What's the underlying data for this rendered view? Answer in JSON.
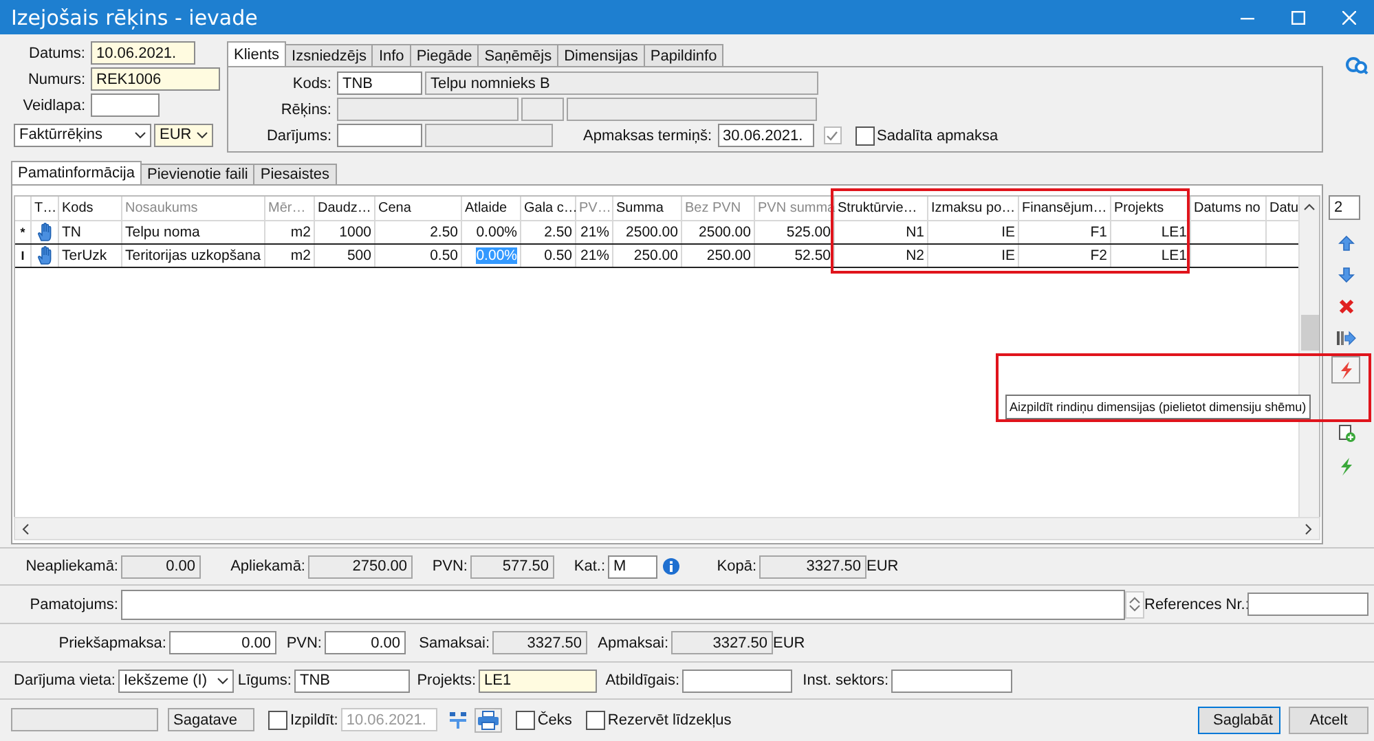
{
  "window": {
    "title": "Izejošais rēķins - ievade"
  },
  "header": {
    "datums": {
      "label": "Datums:",
      "value": "10.06.2021.",
      "highlighted": true
    },
    "numurs": {
      "label": "Numurs:",
      "value": "REK1006",
      "highlighted": true
    },
    "veidlapa": {
      "label": "Veidlapa:"
    },
    "doc_type": "Faktūrrēķins",
    "currency": "EUR"
  },
  "party_tabs": [
    {
      "label": "Klients",
      "selected": true
    },
    {
      "label": "Izsniedzējs",
      "selected": false
    },
    {
      "label": "Info",
      "selected": false
    },
    {
      "label": "Piegāde",
      "selected": false
    },
    {
      "label": "Saņēmējs",
      "selected": false
    },
    {
      "label": "Dimensijas",
      "selected": false
    },
    {
      "label": "Papildinfo",
      "selected": false
    }
  ],
  "client": {
    "kods_label": "Kods:",
    "kods": "TNB",
    "name": "Telpu nomnieks B",
    "rekins_label": "Rēķins:",
    "darijums_label": "Darījums:",
    "payment_term_label": "Apmaksas termiņš:",
    "payment_term": "30.06.2021.",
    "term_checked": true,
    "split_payment": {
      "label": "Sadalīta apmaksa",
      "checked": false
    }
  },
  "detail_tabs": [
    {
      "label": "Pamatinformācija",
      "selected": true
    },
    {
      "label": "Pievienotie faili",
      "selected": false
    },
    {
      "label": "Piesaistes",
      "selected": false
    }
  ],
  "table": {
    "columns": [
      {
        "label": "T…",
        "greyed": false
      },
      {
        "label": "Kods",
        "greyed": false
      },
      {
        "label": "Nosaukums",
        "greyed": true
      },
      {
        "label": "Mēr…",
        "greyed": true
      },
      {
        "label": "Daudz…",
        "greyed": false
      },
      {
        "label": "Cena",
        "greyed": false
      },
      {
        "label": "Atlaide",
        "greyed": false
      },
      {
        "label": "Gala c…",
        "greyed": false
      },
      {
        "label": "PV…",
        "greyed": true
      },
      {
        "label": "Summa",
        "greyed": false
      },
      {
        "label": "Bez PVN",
        "greyed": true
      },
      {
        "label": "PVN summa",
        "greyed": true
      },
      {
        "label": "Struktūrvie…",
        "greyed": false
      },
      {
        "label": "Izmaksu po…",
        "greyed": false
      },
      {
        "label": "Finansējum…",
        "greyed": false
      },
      {
        "label": "Projekts",
        "greyed": false
      },
      {
        "label": "Datums no",
        "greyed": false
      },
      {
        "label": "Datu",
        "greyed": false
      }
    ],
    "rows": [
      {
        "marker": "*",
        "cells": [
          "",
          "TN",
          "Telpu noma",
          "m2",
          "1000",
          "2.50",
          "0.00%",
          "2.50",
          "21%",
          "2500.00",
          "2500.00",
          "525.00",
          "N1",
          "IE",
          "F1",
          "LE1"
        ],
        "discount_selected": false
      },
      {
        "marker": "I",
        "cells": [
          "",
          "TerUzk",
          "Teritorijas uzkopšana",
          "m2",
          "500",
          "0.50",
          "0.00%",
          "0.50",
          "21%",
          "250.00",
          "250.00",
          "52.50",
          "N2",
          "IE",
          "F2",
          "LE1"
        ],
        "discount_selected": true
      }
    ]
  },
  "toolbar": {
    "counter": "2"
  },
  "tooltip": {
    "text": "Aizpildīt rindiņu dimensijas (pielietot dimensiju shēmu)"
  },
  "totals": {
    "neapliekama": {
      "label": "Neapliekamā:",
      "value": "0.00"
    },
    "apliekama": {
      "label": "Apliekamā:",
      "value": "2750.00"
    },
    "pvn": {
      "label": "PVN:",
      "value": "577.50"
    },
    "kat": {
      "label": "Kat.:",
      "value": "M"
    },
    "kopa": {
      "label": "Kopā:",
      "value": "3327.50"
    },
    "currency": "EUR"
  },
  "pamatojums": {
    "label": "Pamatojums:"
  },
  "references": {
    "label": "References Nr.:"
  },
  "payments": {
    "priekšapmaksa": {
      "label": "Priekšapmaksa:",
      "value": "0.00"
    },
    "pvn": {
      "label": "PVN:",
      "value": "0.00"
    },
    "samaksai": {
      "label": "Samaksai:",
      "value": "3327.50"
    },
    "apmaksai": {
      "label": "Apmaksai:",
      "value": "3327.50"
    },
    "currency": "EUR"
  },
  "details": {
    "darijuma_vieta": {
      "label": "Darījuma vieta:",
      "value": "Iekšzeme (I)"
    },
    "ligums": {
      "label": "Līgums:",
      "value": "TNB"
    },
    "projekts": {
      "label": "Projekts:",
      "value": "LE1",
      "highlighted": true
    },
    "atbildigais": {
      "label": "Atbildīgais:"
    },
    "inst_sektors": {
      "label": "Inst. sektors:"
    }
  },
  "footer": {
    "status": "Sagatave",
    "izpildit": {
      "label": "Izpildīt:",
      "checked": false,
      "date": "10.06.2021."
    },
    "ceks": {
      "label": "Čeks",
      "checked": false
    },
    "rezervet": {
      "label": "Rezervēt līdzekļus",
      "checked": false
    },
    "buttons": [
      "Saglabāt",
      "Atcelt"
    ]
  }
}
